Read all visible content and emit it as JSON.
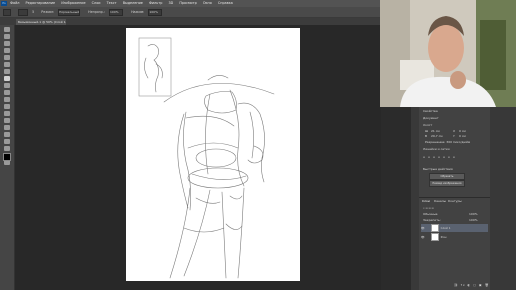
{
  "menubar": {
    "app_icon": "Ps",
    "items": [
      "Файл",
      "Редактирование",
      "Изображение",
      "Слои",
      "Текст",
      "Выделение",
      "Фильтр",
      "3D",
      "Просмотр",
      "Окно",
      "Справка"
    ]
  },
  "options_bar": {
    "brush_size": "5",
    "mode_label": "Режим:",
    "mode_value": "Нормальный",
    "opacity_label": "Непрозр.:",
    "opacity_value": "100%",
    "flow_label": "Нажим:",
    "flow_value": "100%"
  },
  "document_tab": {
    "title": "Безымянный-1 @ 50% (Слой 1, RGB/8)"
  },
  "properties_panel": {
    "title": "Свойства",
    "section": "Документ",
    "canvas_label": "Холст",
    "w_label": "Ш",
    "w_value": "21 см",
    "h_label": "В",
    "h_value": "29,7 см",
    "x_label": "X",
    "x_value": "0 см",
    "y_label": "Y",
    "y_value": "0 см",
    "resolution": "Разрешение: 300 пикс/дюйм",
    "rulers_label": "Линейки и сетки",
    "quick_actions": "Быстрые действия",
    "btn_trim": "Обрезать",
    "btn_resize": "Размер изображения"
  },
  "layers_panel": {
    "tabs": [
      "Слои",
      "Каналы",
      "Контуры"
    ],
    "blend_mode": "Обычные",
    "opacity": "100%",
    "lock_label": "Закрепить:",
    "fill": "100%",
    "layers": [
      {
        "name": "Слой 1",
        "selected": true
      },
      {
        "name": "Фон",
        "selected": false
      }
    ]
  },
  "colors": {
    "accent": "#2d6ab0",
    "foreground_swatch": "#000000",
    "background_swatch": "#ffffff"
  }
}
